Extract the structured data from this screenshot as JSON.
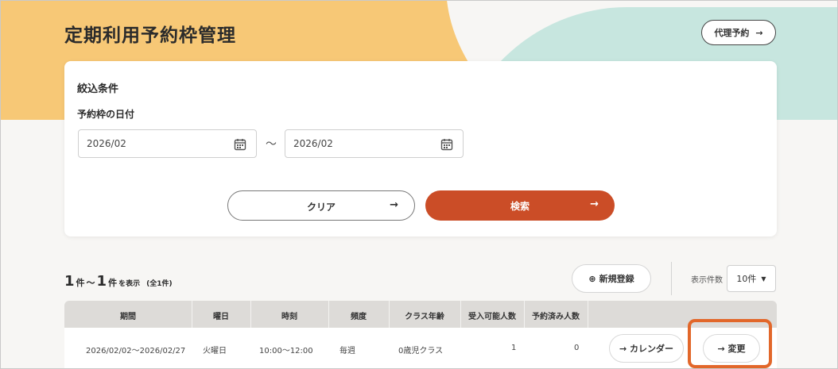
{
  "header": {
    "title": "定期利用予約枠管理",
    "proxy_button": "代理予約",
    "proxy_arrow": "→"
  },
  "filter": {
    "title": "絞込条件",
    "date_label": "予約枠の日付",
    "from_value": "2026/02",
    "to_value": "2026/02",
    "separator": "～",
    "clear_label": "クリア",
    "clear_arrow": "→",
    "search_label": "検索",
    "search_arrow": "→"
  },
  "results": {
    "count_start": "1",
    "count_unit_a": "件",
    "count_tilde": "～",
    "count_end": "1",
    "count_unit_b": "件",
    "count_suffix": "を表示",
    "count_total": "(全1件)",
    "new_button": "新規登録",
    "new_icon_glyph": "⊕",
    "per_page_label": "表示件数",
    "per_page_value": "10件",
    "per_page_caret": "▼"
  },
  "table": {
    "headers": [
      "期間",
      "曜日",
      "時刻",
      "頻度",
      "クラス年齢",
      "受入可能人数",
      "予約済み人数"
    ],
    "rows": [
      {
        "period": "2026/02/02～2026/02/27",
        "weekday": "火曜日",
        "time": "10:00～12:00",
        "frequency": "毎週",
        "class_age": "0歳児クラス",
        "capacity": "1",
        "reserved": "0",
        "calendar_button": "→ カレンダー",
        "change_button": "→ 変更"
      }
    ]
  },
  "colors": {
    "accent_orange": "#cb4d27",
    "highlight": "#e2672a",
    "bg_yellow": "#f7c876",
    "bg_teal": "#c7e6df"
  }
}
